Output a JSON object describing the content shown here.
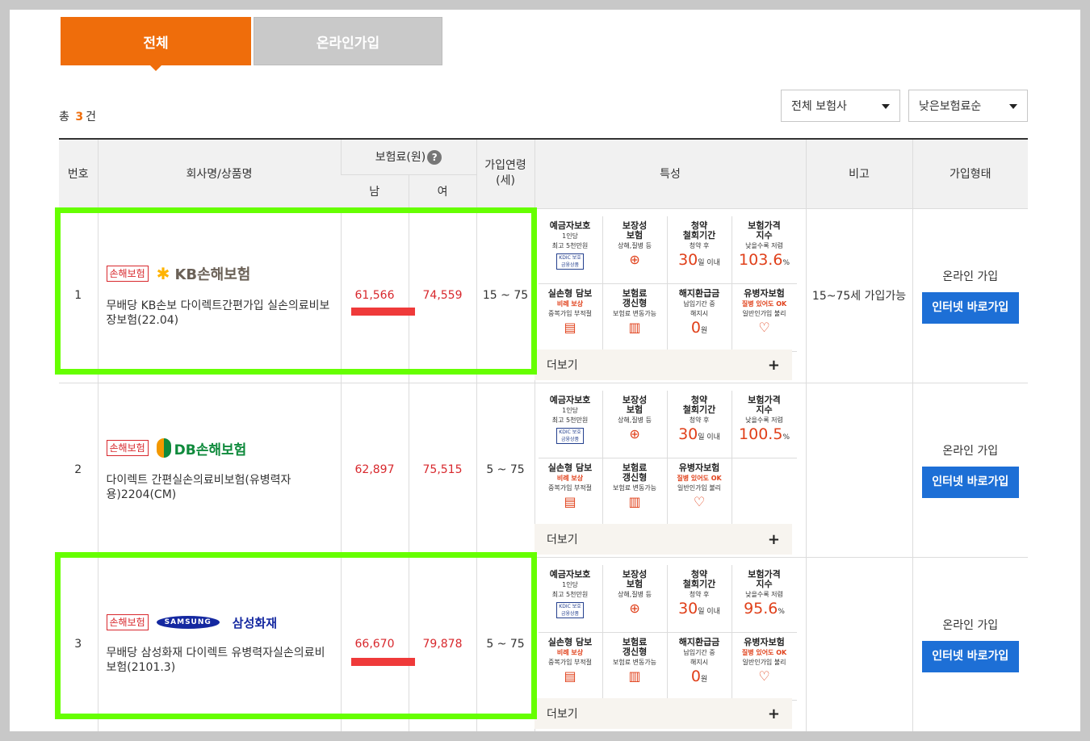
{
  "tabs": [
    {
      "label": "전체",
      "active": true
    },
    {
      "label": "온라인가입",
      "active": false
    }
  ],
  "summary": {
    "prefix": "총",
    "count": "3",
    "suffix": "건"
  },
  "filters": {
    "company": "전체 보험사",
    "sort": "낮은보험료순"
  },
  "table": {
    "headers": {
      "no": "번호",
      "company": "회사명/상품명",
      "premium": "보험료(원)",
      "premium_help": "?",
      "male": "남",
      "female": "여",
      "age": "가입연령\n(세)",
      "features": "특성",
      "note": "비고",
      "join_type": "가입형태"
    },
    "rows": [
      {
        "no": "1",
        "badge": "손해보험",
        "logo_text": "KB손해보험",
        "product": "무배당 KB손보 다이렉트간편가입 실손의료비보장보험(22.04)",
        "male": "61,566",
        "female": "74,559",
        "age": "15 ~ 75",
        "note": "15~75세 가입가능",
        "join_label": "온라인 가입",
        "join_button": "인터넷 바로가입",
        "features": {
          "deposit_title": "예금자보호",
          "deposit_sub1": "1인당",
          "deposit_sub2": "최고 5천만원",
          "deposit_mark": "KDIC 보호금융상품",
          "cover_title": "보장성\n보험",
          "cover_sub": "상해,질병 등",
          "withdraw_title": "청약\n철회기간",
          "withdraw_sub": "청약 후",
          "withdraw_num": "30",
          "withdraw_unit": "일 이내",
          "index_title": "보험가격\n지수",
          "index_sub": "낮을수록 저렴",
          "index_num": "103.6",
          "index_unit": "%",
          "actual_title": "실손형 담보",
          "actual_red": "비례 보상",
          "actual_sub": "중복가입 부적절",
          "renew_title": "보험료\n갱신형",
          "renew_sub": "보험료 변동가능",
          "refund_title": "해지환급금",
          "refund_sub1": "납입기간 중",
          "refund_sub2": "해지시",
          "refund_num": "0",
          "refund_unit": "원",
          "sick_title": "유병자보험",
          "sick_red": "질병 있어도 OK",
          "sick_sub": "일반인가입 불리",
          "more_label": "더보기"
        }
      },
      {
        "no": "2",
        "badge": "손해보험",
        "logo_text": "DB손해보험",
        "product": "다이렉트 간편실손의료비보험(유병력자용)2204(CM)",
        "male": "62,897",
        "female": "75,515",
        "age": "5 ~ 75",
        "note": "",
        "join_label": "온라인 가입",
        "join_button": "인터넷 바로가입",
        "features": {
          "deposit_title": "예금자보호",
          "deposit_sub1": "1인당",
          "deposit_sub2": "최고 5천만원",
          "deposit_mark": "KDIC 보호금융상품",
          "cover_title": "보장성\n보험",
          "cover_sub": "상해,질병 등",
          "withdraw_title": "청약\n철회기간",
          "withdraw_sub": "청약 후",
          "withdraw_num": "30",
          "withdraw_unit": "일 이내",
          "index_title": "보험가격\n지수",
          "index_sub": "낮을수록 저렴",
          "index_num": "100.5",
          "index_unit": "%",
          "actual_title": "실손형 담보",
          "actual_red": "비례 보상",
          "actual_sub": "중복가입 부적절",
          "renew_title": "보험료\n갱신형",
          "renew_sub": "보험료 변동가능",
          "sick_title": "유병자보험",
          "sick_red": "질병 있어도 OK",
          "sick_sub": "일반인가입 불리",
          "more_label": "더보기"
        }
      },
      {
        "no": "3",
        "badge": "손해보험",
        "logo_text": "삼성화재",
        "logo_oval": "SAMSUNG",
        "product": "무배당 삼성화재 다이렉트 유병력자실손의료비보험(2101.3)",
        "male": "66,670",
        "female": "79,878",
        "age": "5 ~ 75",
        "note": "",
        "join_label": "온라인 가입",
        "join_button": "인터넷 바로가입",
        "features": {
          "deposit_title": "예금자보호",
          "deposit_sub1": "1인당",
          "deposit_sub2": "최고 5천만원",
          "deposit_mark": "KDIC 보호금융상품",
          "cover_title": "보장성\n보험",
          "cover_sub": "상해,질병 등",
          "withdraw_title": "청약\n철회기간",
          "withdraw_sub": "청약 후",
          "withdraw_num": "30",
          "withdraw_unit": "일 이내",
          "index_title": "보험가격\n지수",
          "index_sub": "낮을수록 저렴",
          "index_num": "95.6",
          "index_unit": "%",
          "actual_title": "실손형 담보",
          "actual_red": "비례 보상",
          "actual_sub": "중복가입 부적절",
          "renew_title": "보험료\n갱신형",
          "renew_sub": "보험료 변동가능",
          "refund_title": "해지환급금",
          "refund_sub1": "납입기간 중",
          "refund_sub2": "해지시",
          "refund_num": "0",
          "refund_unit": "원",
          "sick_title": "유병자보험",
          "sick_red": "질병 있어도 OK",
          "sick_sub": "일반인가입 불리",
          "more_label": "더보기"
        }
      }
    ]
  },
  "colors": {
    "accent": "#ef6d0b",
    "price": "#d8282d",
    "button": "#1d6fd6",
    "highlight": "#66ff00",
    "marker": "#ef3a3a"
  }
}
